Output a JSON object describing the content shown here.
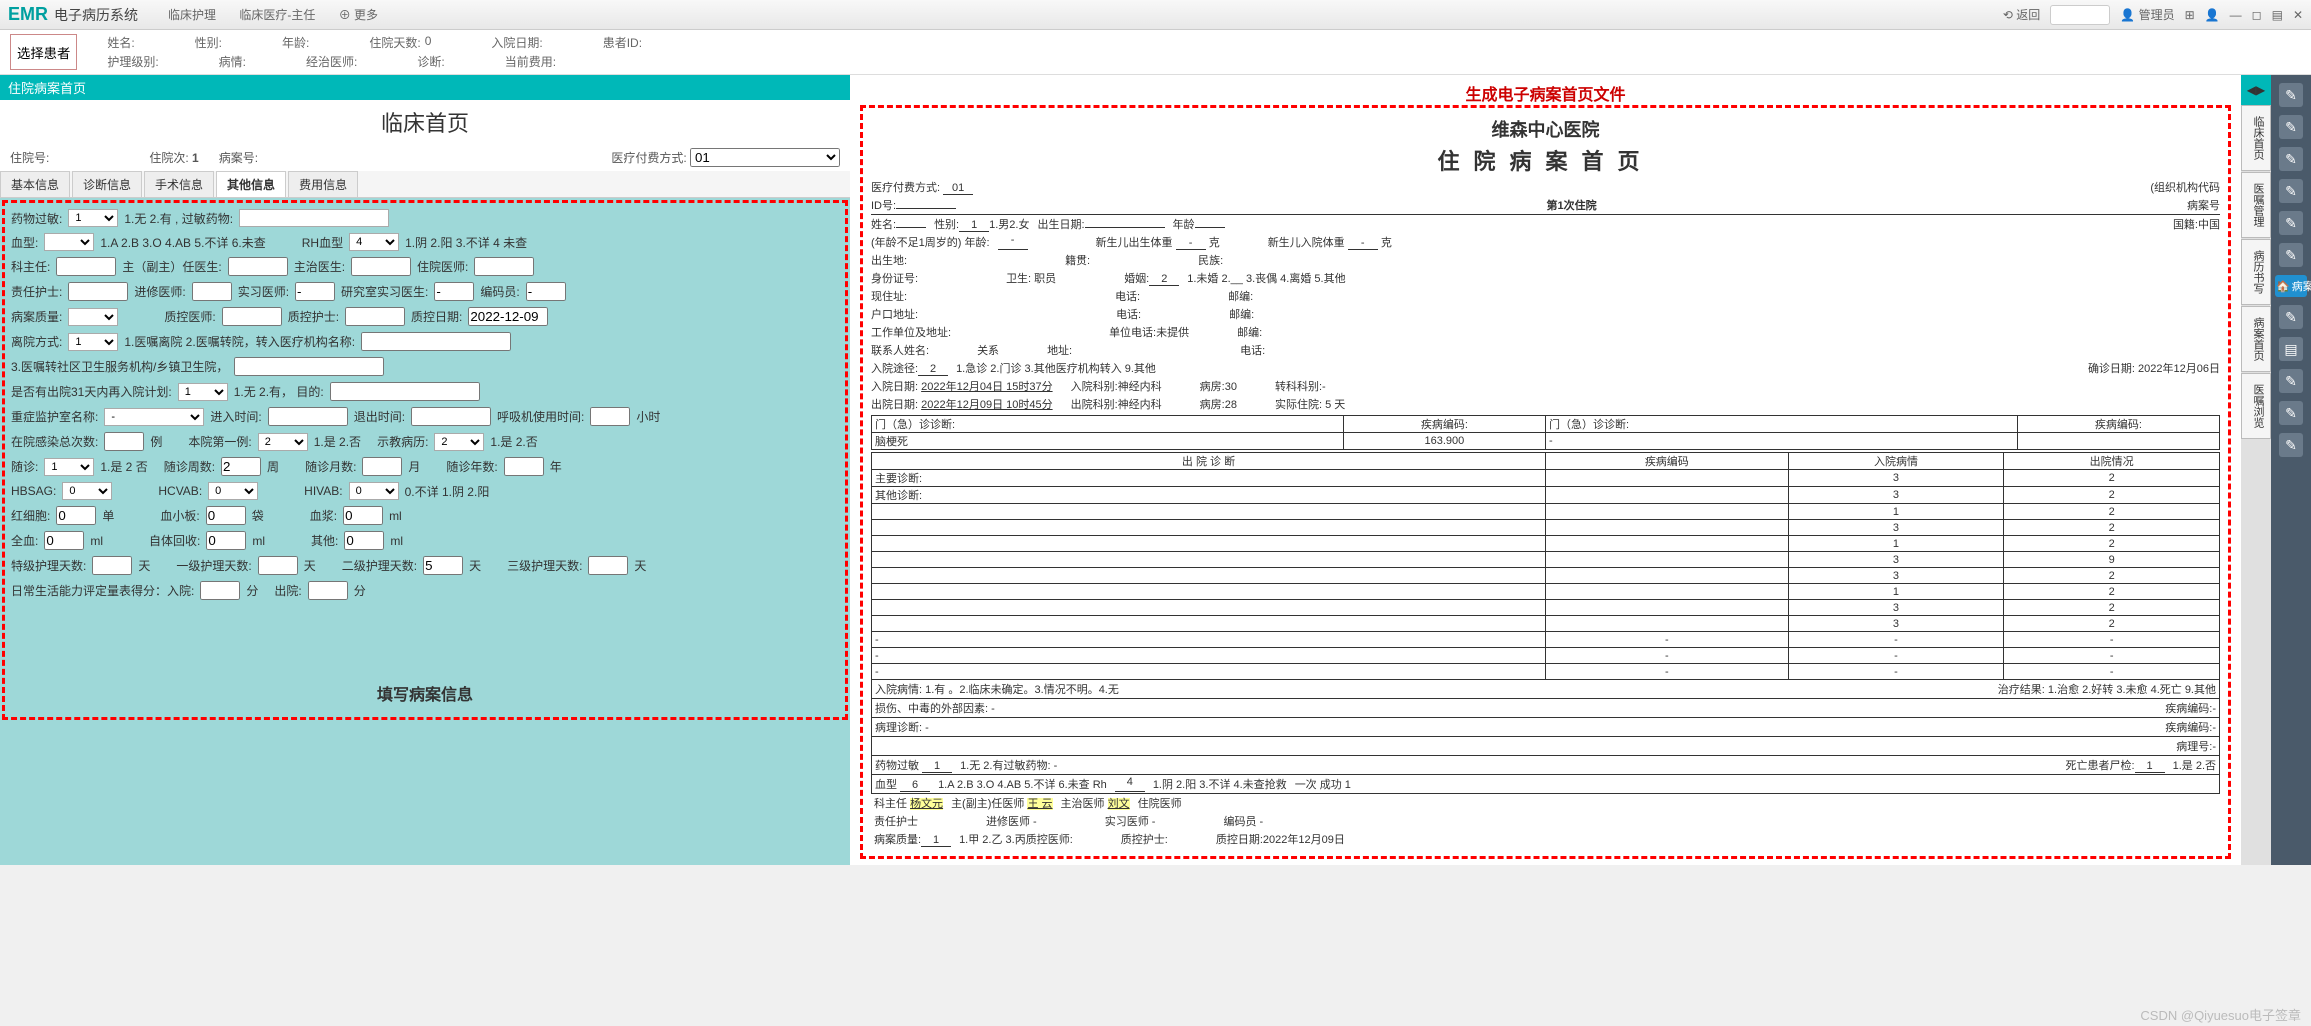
{
  "top": {
    "logo": "EMR",
    "logo_sub": "电子病历系统",
    "menu": [
      "临床护理",
      "临床医疗-主任",
      "更多"
    ],
    "back": "返回",
    "admin": "管理员"
  },
  "infobar": {
    "row1": {
      "name_l": "姓名:",
      "sex_l": "性别:",
      "age_l": "年龄:",
      "days_l": "住院天数:",
      "days_v": "0",
      "indate_l": "入院日期:",
      "pid_l": "患者ID:"
    },
    "row2": {
      "level_l": "护理级别:",
      "cond_l": "病情:",
      "doc_l": "经治医师:",
      "diag_l": "诊断:",
      "fee_l": "当前费用:"
    }
  },
  "left": {
    "section_title": "住院病案首页",
    "h2": "临床首页",
    "head_row": {
      "zyh_l": "住院号:",
      "zycs_l": "住院次:",
      "zycs_v": "1",
      "bah_l": "病案号:",
      "pay_l": "医疗付费方式:",
      "pay_v": "01"
    },
    "tabs": [
      "基本信息",
      "诊断信息",
      "手术信息",
      "其他信息",
      "费用信息"
    ],
    "active_tab": 3,
    "form": {
      "r1": {
        "allergy_l": "药物过敏:",
        "allergy_v": "1",
        "allergy_opts": "1.无 2.有 , 过敏药物:"
      },
      "r2": {
        "blood_l": "血型:",
        "blood_opts": "1.A  2.B  3.O  4.AB  5.不详 6.未查",
        "rh_l": "RH血型",
        "rh_v": "4",
        "rh_opts": "1.阴  2.阳  3.不详 4 未查"
      },
      "r3": {
        "kzr_l": "科主任:",
        "zfz_l": "主（副主）任医生:",
        "zzys_l": "主治医生:",
        "zyys_l": "住院医师:"
      },
      "r4": {
        "zrhs_l": "责任护士:",
        "jxys_l": "进修医师:",
        "sxys_l": "实习医师:",
        "yjs_l": "研究室实习医生:",
        "bmy_l": "编码员:"
      },
      "r5": {
        "bazl_l": "病案质量:",
        "zkys_l": "质控医师:",
        "zkhs_l": "质控护士:",
        "zkrq_l": "质控日期:",
        "zkrq_v": "2022-12-09"
      },
      "r6": {
        "cyfs_l": "离院方式:",
        "cyfs_v": "1",
        "cyfs_opts": "1.医嘱离院  2.医嘱转院，转入医疗机构名称:"
      },
      "r7": {
        "t": "3.医嘱转社区卫生服务机构/乡镇卫生院，"
      },
      "r8": {
        "again_l": "是否有出院31天内再入院计划:",
        "again_v": "1",
        "again_opts": "1.无  2.有，  目的:"
      },
      "r9": {
        "icu_l": "重症监护室名称:",
        "in_l": "进入时间:",
        "out_l": "退出时间:",
        "vent_l": "呼吸机使用时间:",
        "vent_u": "小时"
      },
      "r10": {
        "inf_l": "在院感染总次数:",
        "unit1": "例",
        "first_l": "本院第一例:",
        "first_v": "2",
        "first_opts": "1.是 2.否",
        "teach_l": "示教病历:",
        "teach_v": "2",
        "teach_opts": "1.是 2.否"
      },
      "r11": {
        "sz_l": "随诊:",
        "sz_v": "1",
        "sz_opts": "1.是 2 否",
        "szzq_l": "随诊周数:",
        "szzq_v": "2",
        "szzq_u": "周",
        "szy_l": "随诊月数:",
        "szy_u": "月",
        "szn_l": "随诊年数:",
        "szn_u": "年"
      },
      "r12": {
        "hbsag_l": "HBSAG:",
        "hbsag_v": "0",
        "hcv_l": "HCVAB:",
        "hcv_v": "0",
        "hiv_l": "HIVAB:",
        "hiv_v": "0",
        "opts": "0.不详 1.阴  2.阳"
      },
      "r13": {
        "rbc_l": "红细胞:",
        "rbc_v": "0",
        "rbc_u": "单",
        "plt_l": "血小板:",
        "plt_v": "0",
        "plt_u": "袋",
        "plasma_l": "血浆:",
        "plasma_v": "0",
        "plasma_u": "ml"
      },
      "r14": {
        "whole_l": "全血:",
        "whole_v": "0",
        "whole_u": "ml",
        "self_l": "自体回收:",
        "self_v": "0",
        "self_u": "ml",
        "other_l": "其他:",
        "other_v": "0",
        "other_u": "ml"
      },
      "r15": {
        "sp_l": "特级护理天数:",
        "sp_u": "天",
        "l1_l": "一级护理天数:",
        "l1_u": "天",
        "l2_l": "二级护理天数:",
        "l2_v": "5",
        "l2_u": "天",
        "l3_l": "三级护理天数:",
        "l3_u": "天"
      },
      "r16": {
        "adl_l": "日常生活能力评定量表得分：入院:",
        "adl_u1": "分",
        "out_l": "出院:",
        "adl_u2": "分"
      }
    },
    "caption": "填写病案信息"
  },
  "right": {
    "annot": "生成电子病案首页文件",
    "hospital": "维森中心医院",
    "doc_title": "住院病案首页",
    "l1": {
      "pay_l": "医疗付费方式:",
      "pay_v": "01",
      "org_l": "(组织机构代码"
    },
    "l2": {
      "id_l": "ID号:",
      "times": "第1次住院",
      "bah_l": "病案号"
    },
    "l3": {
      "name_l": "姓名:",
      "sex_l": "性别:",
      "sex_v": "1",
      "sex_opts": "1.男2.女",
      "birth_l": "出生日期:",
      "age_l": "年龄",
      "nation_l": "国籍:中国"
    },
    "l4": {
      "pre": "(年龄不足1周岁的)  年龄:",
      "nb_w_l": "新生儿出生体重",
      "nb_w_u": "克",
      "nb_in_l": "新生儿入院体重",
      "nb_in_u": "克"
    },
    "l5": {
      "birth_place_l": "出生地:",
      "native_l": "籍贯:",
      "ethnic_l": "民族:"
    },
    "l6": {
      "id_l": "身份证号:",
      "job_l": "卫生: 职员",
      "marry_l": "婚姻:",
      "marry_v": "2",
      "marry_opts": "1.未婚 2.__   3.丧偶 4.离婚 5.其他"
    },
    "l7": {
      "addr_l": "现住址:",
      "tel_l": "电话:",
      "zip_l": "邮编:"
    },
    "l8": {
      "hk_l": "户口地址:",
      "tel_l": "电话:",
      "zip_l": "邮编:"
    },
    "l9": {
      "work_l": "工作单位及地址:",
      "tel_l": "单位电话:未提供",
      "zip_l": "邮编:"
    },
    "l10": {
      "contact_l": "联系人姓名:",
      "rel_l": "关系",
      "addr_l": "地址:",
      "tel_l": "电话:"
    },
    "l11": {
      "in_way_l": "入院途径:",
      "in_way_v": "2",
      "in_way_opts": "1.急诊 2.门诊 3.其他医疗机构转入 9.其他",
      "diag_date_l": "确诊日期: 2022年12月06日"
    },
    "l12": {
      "in_date_l": "入院日期:",
      "in_date_v": "2022年12月04日 15时37分",
      "in_dept_l": "入院科别:神经内科",
      "ward_l": "病房:30",
      "trans_l": "转科科别:-"
    },
    "l13": {
      "out_date_l": "出院日期:",
      "out_date_v": "2022年12月09日 10时45分",
      "out_dept_l": "出院科别:神经内科",
      "ward_l": "病房:28",
      "days_l": "实际住院: 5  天"
    },
    "table_head": {
      "mz_l": "门（急）诊诊断:",
      "code_l": "疾病编码:",
      "mz2_l": "门（急）诊诊断:",
      "code2_l": "疾病编码:"
    },
    "mz_diag": {
      "name": "脑梗死",
      "code": "163.900",
      "name2": "-",
      "code2": ""
    },
    "cols": [
      "出 院 诊 断",
      "疾病编码",
      "入院病情",
      "出院情况"
    ],
    "rows": [
      {
        "label": "主要诊断:",
        "code": "",
        "in": "3",
        "out": "2"
      },
      {
        "label": "其他诊断:",
        "code": "",
        "in": "3",
        "out": "2"
      },
      {
        "label": "",
        "code": "",
        "in": "1",
        "out": "2"
      },
      {
        "label": "",
        "code": "",
        "in": "3",
        "out": "2"
      },
      {
        "label": "",
        "code": "",
        "in": "1",
        "out": "2"
      },
      {
        "label": "",
        "code": "",
        "in": "3",
        "out": "9"
      },
      {
        "label": "",
        "code": "",
        "in": "3",
        "out": "2"
      },
      {
        "label": "",
        "code": "",
        "in": "1",
        "out": "2"
      },
      {
        "label": "",
        "code": "",
        "in": "3",
        "out": "2"
      },
      {
        "label": "",
        "code": "",
        "in": "3",
        "out": "2"
      },
      {
        "label": "-",
        "code": "-",
        "in": "-",
        "out": "-"
      },
      {
        "label": "-",
        "code": "-",
        "in": "-",
        "out": "-"
      },
      {
        "label": "-",
        "code": "-",
        "in": "-",
        "out": "-"
      }
    ],
    "ll1": {
      "t": "入院病情: 1.有 。2.临床未确定。3.情况不明。4.无",
      "t2": "治疗结果: 1.治愈  2.好转  3.未愈  4.死亡 9.其他"
    },
    "ll2": {
      "t": "损伤、中毒的外部因素: -",
      "code_l": "疾病编码:-"
    },
    "ll3": {
      "t": "病理诊断: -",
      "code_l": "疾病编码:-"
    },
    "ll3b": {
      "t2": "病理号:-"
    },
    "ll4": {
      "t": "药物过敏",
      "v": "1",
      "opts": "1.无   2.有过敏药物: -",
      "death_l": "死亡患者尸检:",
      "death_v": "1",
      "death_opts": "1.是 2.否"
    },
    "ll5": {
      "t": "血型",
      "v": "6",
      "opts": "1.A  2.B  3.O  4.AB  5.不详  6.未查   Rh",
      "rh_v": "4",
      "rh_opts": "1.阴  2.阳  3.不详  4.未查抢救",
      "rescue": "一次  成功  1"
    },
    "ll6": {
      "kzr": "科主任",
      "kzr_v": "杨文元",
      "zfz": "主(副主)任医师",
      "zfz_v": "王 云",
      "zz": "主治医师",
      "zz_v": "刘文",
      "zy": "住院医师"
    },
    "ll7": {
      "zrhs": "责任护士",
      "jx": "进修医师 -",
      "sx": "实习医师 -",
      "bmy": "编码员 -"
    },
    "ll8": {
      "bazl": "病案质量:",
      "bazl_v": "1",
      "opts": "1.甲 2.乙 3.丙质控医师:",
      "zkhs": "质控护士:",
      "zkrq": "质控日期:2022年12月09日"
    }
  },
  "sidetabs": [
    "临床首页",
    "医嘱管理",
    "病历书写",
    "病案首页",
    "医嘱浏览"
  ],
  "sidetab_active": 3,
  "farright_label": "病案首页",
  "watermark": "CSDN @Qiyuesuo电子签章"
}
